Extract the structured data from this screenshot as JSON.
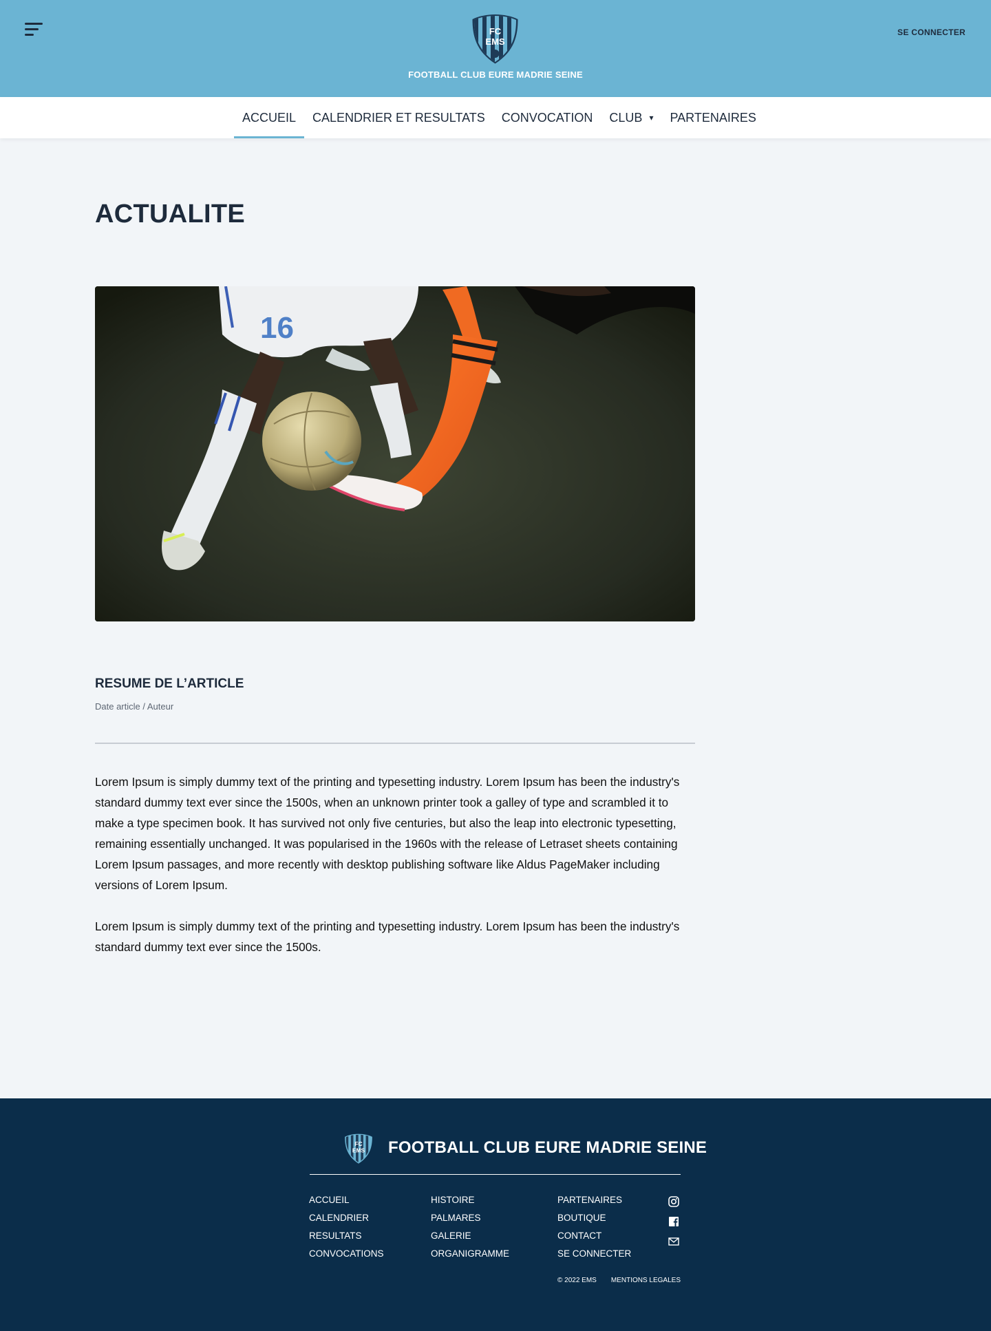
{
  "header": {
    "logo_initials_top": "FC",
    "logo_initials_bottom": "EMS",
    "club_name": "FOOTBALL CLUB EURE MADRIE SEINE",
    "login_label": "SE CONNECTER",
    "accent_color": "#6bb4d3",
    "menu_icon": "hamburger-menu-icon"
  },
  "nav": {
    "items": [
      {
        "label": "ACCUEIL",
        "active": true
      },
      {
        "label": "CALENDRIER ET RESULTATS",
        "active": false
      },
      {
        "label": "CONVOCATION",
        "active": false
      },
      {
        "label": "CLUB",
        "active": false,
        "has_dropdown": true,
        "dropdown_glyph": "▾"
      },
      {
        "label": "PARTENAIRES",
        "active": false
      }
    ]
  },
  "main": {
    "page_title": "ACTUALITE",
    "hero_image": "soccer-players-ball-photo",
    "article_title": "RESUME DE L’ARTICLE",
    "article_meta": "Date article / Auteur",
    "paragraphs": [
      "Lorem Ipsum is simply dummy text of the printing and typesetting industry. Lorem Ipsum has been the industry's standard dummy text ever since the 1500s, when an unknown printer took a galley of type and scrambled it to make a type specimen book. It has survived not only five centuries, but also the leap into electronic typesetting, remaining essentially unchanged. It was popularised in the 1960s with the release of Letraset sheets containing Lorem Ipsum passages, and more recently with desktop publishing software like Aldus PageMaker including versions of Lorem Ipsum.",
      "Lorem Ipsum is simply dummy text of the printing and typesetting industry. Lorem Ipsum has been the industry's standard dummy text ever since the 1500s."
    ]
  },
  "footer": {
    "title": "FOOTBALL CLUB EURE MADRIE SEINE",
    "col1": [
      "ACCUEIL",
      "CALENDRIER",
      "RESULTATS",
      "CONVOCATIONS"
    ],
    "col2": [
      "HISTOIRE",
      "PALMARES",
      "GALERIE",
      "ORGANIGRAMME"
    ],
    "col3": [
      "PARTENAIRES",
      "BOUTIQUE",
      "CONTACT",
      "SE CONNECTER"
    ],
    "social_icons": [
      "instagram-icon",
      "facebook-icon",
      "mail-icon"
    ],
    "copyright": "© 2022 EMS",
    "legal": "MENTIONS LEGALES",
    "background_color": "#0b2d4a"
  }
}
